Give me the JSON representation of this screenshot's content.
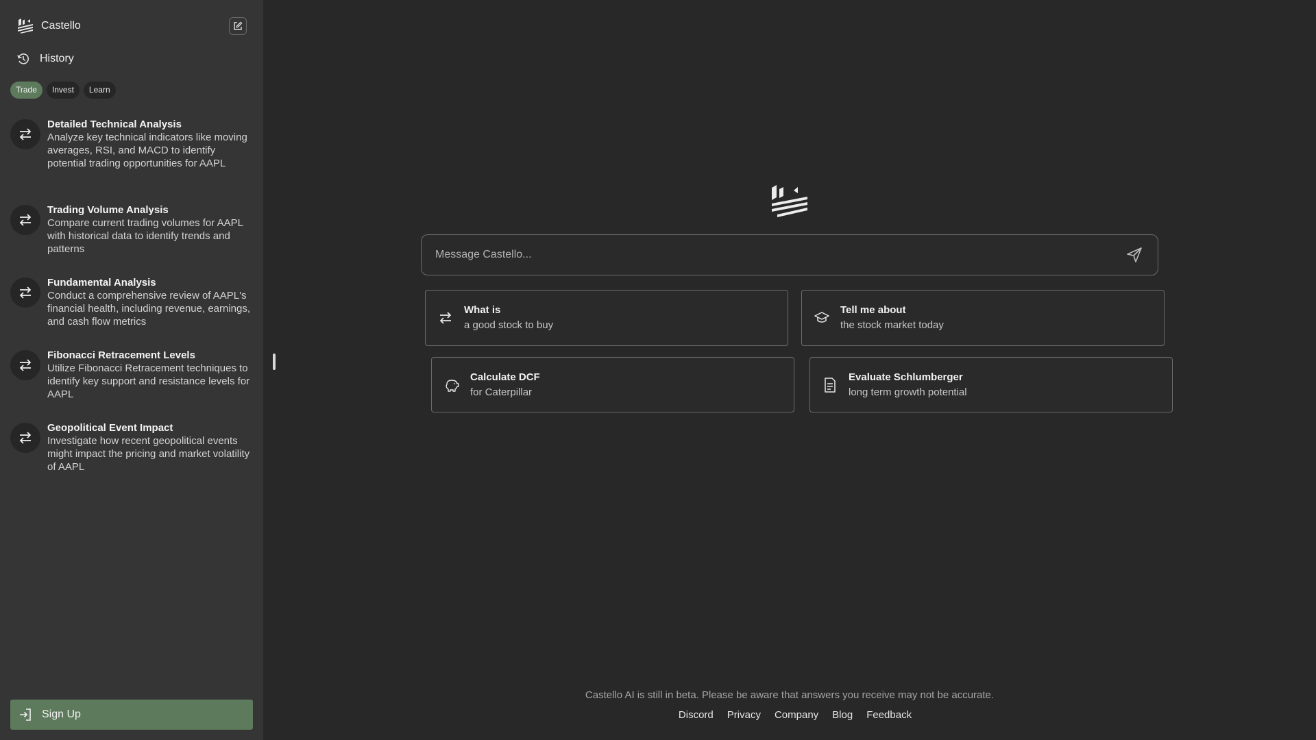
{
  "sidebar": {
    "brand": {
      "name": "Castello",
      "logo_icon": "castello-logo-icon"
    },
    "new_chat_icon": "edit-icon",
    "history": {
      "label": "History",
      "icon": "history-icon"
    },
    "tabs": [
      {
        "label": "Trade",
        "active": true
      },
      {
        "label": "Invest",
        "active": false
      },
      {
        "label": "Learn",
        "active": false
      }
    ],
    "prompts": [
      {
        "title": "Detailed Technical Analysis",
        "description": "Analyze key technical indicators like moving averages, RSI, and MACD to identify potential trading opportunities for AAPL",
        "icon": "swap-arrows-icon"
      },
      {
        "title": "Trading Volume Analysis",
        "description": "Compare current trading volumes for AAPL with historical data to identify trends and patterns",
        "icon": "swap-arrows-icon"
      },
      {
        "title": "Fundamental Analysis",
        "description": "Conduct a comprehensive review of AAPL's financial health, including revenue, earnings, and cash flow metrics",
        "icon": "swap-arrows-icon"
      },
      {
        "title": "Fibonacci Retracement Levels",
        "description": "Utilize Fibonacci Retracement techniques to identify key support and resistance levels for AAPL",
        "icon": "swap-arrows-icon"
      },
      {
        "title": "Geopolitical Event Impact",
        "description": "Investigate how recent geopolitical events might impact the pricing and market volatility of AAPL",
        "icon": "swap-arrows-icon"
      }
    ],
    "signup": {
      "label": "Sign Up",
      "icon": "sign-in-icon"
    }
  },
  "main": {
    "message": {
      "placeholder": "Message Castello...",
      "value": ""
    },
    "suggestions": [
      {
        "title": "What is",
        "subtitle": "a good stock to buy",
        "icon": "swap-arrows-icon"
      },
      {
        "title": "Tell me about",
        "subtitle": "the stock market today",
        "icon": "graduation-cap-icon"
      },
      {
        "title": "Calculate DCF",
        "subtitle": "for Caterpillar",
        "icon": "piggy-bank-icon"
      },
      {
        "title": "Evaluate Schlumberger",
        "subtitle": "long term growth potential",
        "icon": "document-icon"
      }
    ],
    "footer": {
      "disclaimer": "Castello AI is still in beta. Please be aware that answers you receive may not be accurate.",
      "links": [
        "Discord",
        "Privacy",
        "Company",
        "Blog",
        "Feedback"
      ]
    }
  },
  "colors": {
    "sidebar_bg": "#353535",
    "main_bg": "#282828",
    "accent_green": "#5e7a5c",
    "border": "#6c6c6c"
  }
}
